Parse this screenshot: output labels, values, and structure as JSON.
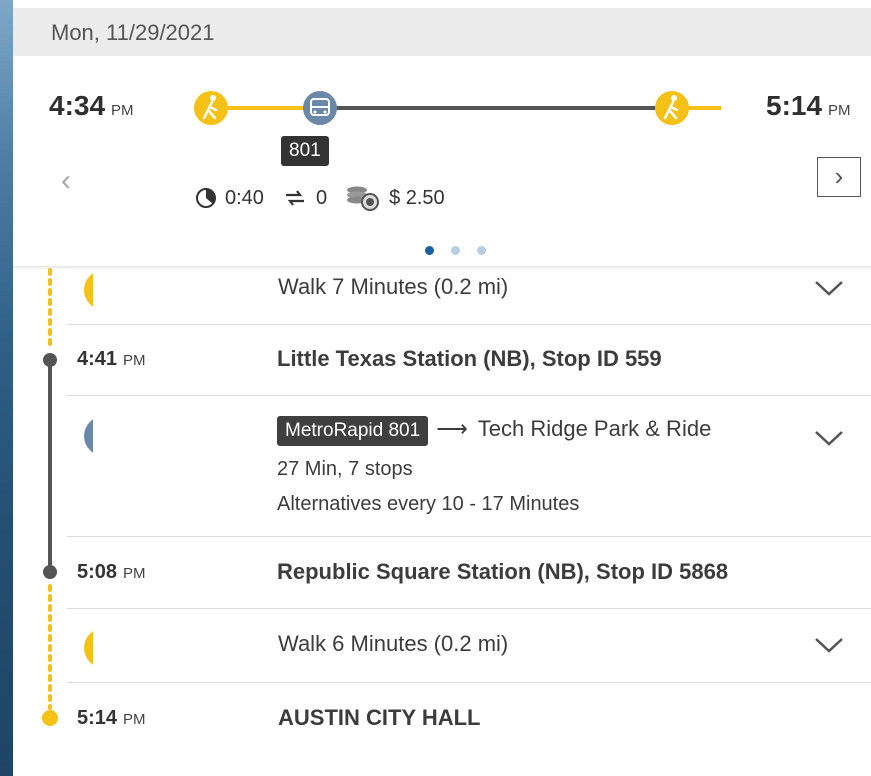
{
  "date": "Mon, 11/29/2021",
  "summary": {
    "depart_time": "4:34",
    "depart_ampm": "PM",
    "arrive_time": "5:14",
    "arrive_ampm": "PM",
    "route_badge": "801",
    "duration": "0:40",
    "transfers": "0",
    "fare": "$ 2.50",
    "page_dots": 3,
    "active_page": 1
  },
  "nav": {
    "prev": "‹",
    "next": "›"
  },
  "steps": {
    "walk1": "Walk 7 Minutes (0.2 mi)",
    "stop1_time": "4:41",
    "stop1_ampm": "PM",
    "stop1_name": "Little Texas Station (NB), Stop ID 559",
    "bus_route": "MetroRapid 801",
    "arrow": "⟶",
    "bus_dest": "Tech Ridge Park & Ride",
    "bus_duration": "27 Min, 7 stops",
    "bus_alt": "Alternatives every 10 - 17 Minutes",
    "stop2_time": "5:08",
    "stop2_ampm": "PM",
    "stop2_name": "Republic Square Station (NB), Stop ID 5868",
    "walk2": "Walk 6 Minutes (0.2 mi)",
    "end_time": "5:14",
    "end_ampm": "PM",
    "end_name": "AUSTIN CITY HALL"
  },
  "colors": {
    "walk_yellow": "#f5c116",
    "bus_blue": "#6b88a8",
    "line_gray": "#555555",
    "dot_active": "#1a5fa0",
    "dot_inactive": "#b9cde3"
  }
}
